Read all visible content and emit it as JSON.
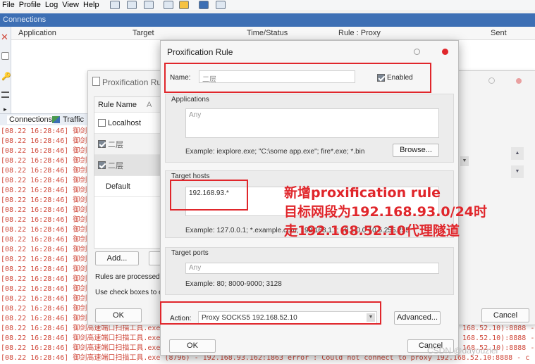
{
  "menu": [
    "File",
    "Profile",
    "Log",
    "View",
    "Help"
  ],
  "connections_title": "Connections",
  "conn_columns": [
    "Application",
    "Target",
    "Time/Status",
    "Rule : Proxy",
    "Sent"
  ],
  "tabs": [
    "Connections",
    "Traffic"
  ],
  "log_lines": [
    "[08.22 16:28:46] 御剑高速",
    "[08.22 16:28:46] 御剑高速",
    "[08.22 16:28:46] 御剑高速",
    "[08.22 16:28:46] 御剑高速",
    "[08.22 16:28:46] 御剑高速",
    "[08.22 16:28:46] 御剑高速",
    "[08.22 16:28:46] 御剑高速",
    "[08.22 16:28:46] 御剑高速",
    "[08.22 16:28:46] 御剑高速",
    "[08.22 16:28:46] 御剑高速",
    "[08.22 16:28:46] 御剑高速",
    "[08.22 16:28:46] 御剑高速",
    "[08.22 16:28:46] 御剑高速",
    "[08.22 16:28:46] 御剑高速",
    "[08.22 16:28:46] 御剑高速",
    "[08.22 16:28:46] 御剑高速",
    "[08.22 16:28:46] 御剑高速",
    "[08.22 16:28:46] 御剑高速",
    "[08.22 16:28:46] 御剑高速",
    "[08.22 16:28:46] 御剑高速",
    "[08.22 16:28:46] 御剑高速端口扫描工具.exe (8",
    "[08.22 16:28:46] 御剑高速端口扫描工具.exe (8",
    "[08.22 16:28:46] 御剑高速端口扫描工具.exe (8",
    "[08.22 16:28:46] 御剑高速端口扫描工具.exe (8796) - 192.168.93.162:1863 error : Could not connect to proxy 192.168.52.10:8888 - c"
  ],
  "log_right_tails": [
    "168.52.10):8888 - c",
    "168.52.10):8888 - c",
    "168.52.10):8888 - c"
  ],
  "rules_dialog": {
    "title": "Proxification Rul",
    "col_rule_name": "Rule Name",
    "col_a": "A",
    "rules": [
      {
        "name": "Localhost",
        "checked": false
      },
      {
        "name": "二层",
        "checked": true
      },
      {
        "name": "二层",
        "checked": true
      },
      {
        "name": "Default",
        "checked": null
      }
    ],
    "add_label": "Add...",
    "processed_text": "Rules are processed fro",
    "checkbox_text": "Use check boxes to ena",
    "ok_label": "OK",
    "cancel_label": "Cancel"
  },
  "prox_dialog": {
    "title": "Proxification Rule",
    "name_label": "Name:",
    "name_value": "二层",
    "enabled_label": "Enabled",
    "applications_label": "Applications",
    "applications_placeholder": "Any",
    "applications_hint": "Example: iexplore.exe; \"C:\\some app.exe\"; fire*.exe; *.bin",
    "browse_label": "Browse...",
    "target_hosts_label": "Target hosts",
    "target_hosts_value": "192.168.93.*",
    "target_hosts_hint": "Example: 127.0.0.1; *.example.com; 192.168.1.*; 10.1.0.0-10.5.255.255",
    "target_ports_label": "Target ports",
    "target_ports_placeholder": "Any",
    "target_ports_hint": "Example: 80; 8000-9000; 3128",
    "action_label": "Action:",
    "action_value": "Proxy SOCKS5 192.168.52.10",
    "advanced_label": "Advanced...",
    "ok_label": "OK",
    "cancel_label": "Cancel"
  },
  "annotation": [
    "新增proxification rule",
    "目标网段为192.168.93.0/24时",
    "走192.168.52.10代理隧道"
  ],
  "watermark": "CSDN @dayouziei",
  "colors": {
    "accent": "#3d6fb4",
    "annotation": "#e0262b",
    "log_text": "#d04a3c",
    "close_dot": "#e0262b"
  }
}
